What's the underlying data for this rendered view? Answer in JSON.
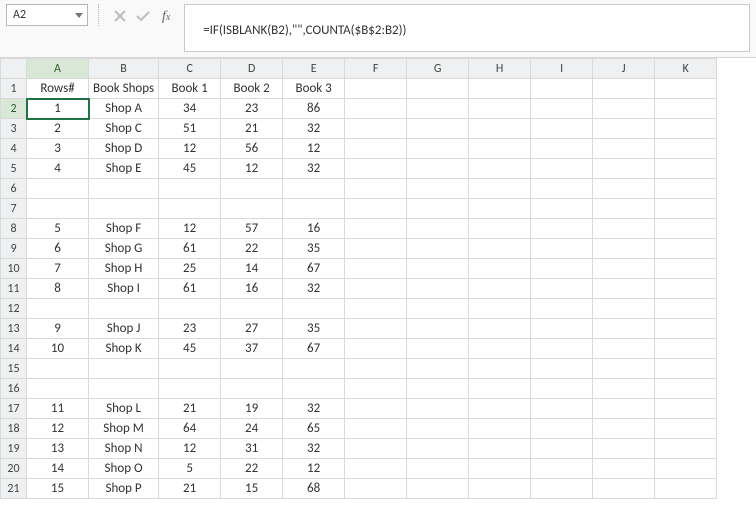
{
  "name_box": "A2",
  "formula": "=IF(ISBLANK(B2),\"\",COUNTA($B$2:B2))",
  "columns": [
    "A",
    "B",
    "C",
    "D",
    "E",
    "F",
    "G",
    "H",
    "I",
    "J",
    "K"
  ],
  "row_count": 21,
  "selected_cell": {
    "row": 2,
    "col": "A"
  },
  "headers": {
    "A": "Rows#",
    "B": "Book Shops",
    "C": "Book 1",
    "D": "Book 2",
    "E": "Book 3"
  },
  "rows": {
    "2": {
      "A": "1",
      "B": "Shop A",
      "C": "34",
      "D": "23",
      "E": "86"
    },
    "3": {
      "A": "2",
      "B": "Shop C",
      "C": "51",
      "D": "21",
      "E": "32"
    },
    "4": {
      "A": "3",
      "B": "Shop D",
      "C": "12",
      "D": "56",
      "E": "12"
    },
    "5": {
      "A": "4",
      "B": "Shop E",
      "C": "45",
      "D": "12",
      "E": "32"
    },
    "6": {},
    "7": {},
    "8": {
      "A": "5",
      "B": "Shop F",
      "C": "12",
      "D": "57",
      "E": "16"
    },
    "9": {
      "A": "6",
      "B": "Shop G",
      "C": "61",
      "D": "22",
      "E": "35"
    },
    "10": {
      "A": "7",
      "B": "Shop H",
      "C": "25",
      "D": "14",
      "E": "67"
    },
    "11": {
      "A": "8",
      "B": "Shop I",
      "C": "61",
      "D": "16",
      "E": "32"
    },
    "12": {},
    "13": {
      "A": "9",
      "B": "Shop J",
      "C": "23",
      "D": "27",
      "E": "35"
    },
    "14": {
      "A": "10",
      "B": "Shop K",
      "C": "45",
      "D": "37",
      "E": "67"
    },
    "15": {},
    "16": {},
    "17": {
      "A": "11",
      "B": "Shop L",
      "C": "21",
      "D": "19",
      "E": "32"
    },
    "18": {
      "A": "12",
      "B": "Shop M",
      "C": "64",
      "D": "24",
      "E": "65"
    },
    "19": {
      "A": "13",
      "B": "Shop N",
      "C": "12",
      "D": "31",
      "E": "32"
    },
    "20": {
      "A": "14",
      "B": "Shop O",
      "C": "5",
      "D": "22",
      "E": "12"
    },
    "21": {
      "A": "15",
      "B": "Shop P",
      "C": "21",
      "D": "15",
      "E": "68"
    }
  }
}
